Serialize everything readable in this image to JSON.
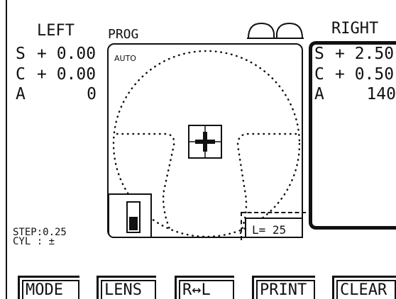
{
  "left": {
    "title": "LEFT",
    "s_label": "S",
    "s_value": "+ 0.00",
    "c_label": "C",
    "c_value": "+ 0.00",
    "a_label": "A",
    "a_value": "0"
  },
  "right": {
    "title": "RIGHT",
    "s_label": "S",
    "s_value": "+ 2.50",
    "c_label": "C",
    "c_value": "+ 0.50",
    "a_label": "A",
    "a_value": "140"
  },
  "mode_label": "PROG",
  "auto_label": "AUTO",
  "glasses_icon": "glasses-icon",
  "target_icon": "crosshair-target-icon",
  "battery": {
    "icon": "battery-icon",
    "level": 0.55
  },
  "l_readout": "L= 25",
  "settings": {
    "step": "STEP:0.25",
    "cyl": "CYL : ±"
  },
  "function_keys": [
    "MODE",
    "LENS",
    "R↔L",
    "PRINT",
    "CLEAR"
  ],
  "colors": {
    "ink": "#111111",
    "background": "#ffffff"
  }
}
